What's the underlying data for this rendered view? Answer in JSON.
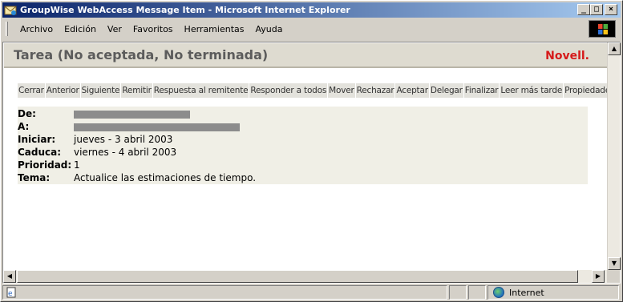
{
  "window": {
    "title": "GroupWise WebAccess Message Item - Microsoft Internet Explorer"
  },
  "window_controls": {
    "minimize": "_",
    "maximize": "□",
    "close": "×"
  },
  "menu": [
    "Archivo",
    "Edición",
    "Ver",
    "Favoritos",
    "Herramientas",
    "Ayuda"
  ],
  "header": {
    "title": "Tarea   (No aceptada, No terminada)",
    "brand": "Novell."
  },
  "actions": [
    "Cerrar",
    "Anterior",
    "Siguiente",
    "Remitir",
    "Respuesta al remitente",
    "Responder a todos",
    "Mover",
    "Rechazar",
    "Aceptar",
    "Delegar",
    "Finalizar",
    "Leer más tarde",
    "Propiedades"
  ],
  "details": {
    "from_label": "De:",
    "to_label": "A:",
    "start_label": "Iniciar:",
    "start_value": "jueves - 3 abril 2003",
    "due_label": "Caduca:",
    "due_value": "viernes - 4 abril 2003",
    "priority_label": "Prioridad:",
    "priority_value": "1",
    "subject_label": "Tema:",
    "subject_value": "Actualice las estimaciones de tiempo."
  },
  "status": {
    "zone": "Internet"
  },
  "colors": {
    "titlebar_start": "#0a246a",
    "titlebar_end": "#a6caf0",
    "brand": "#d61a1a",
    "header_bg": "#dedbd0",
    "details_bg": "#f0efe6"
  }
}
